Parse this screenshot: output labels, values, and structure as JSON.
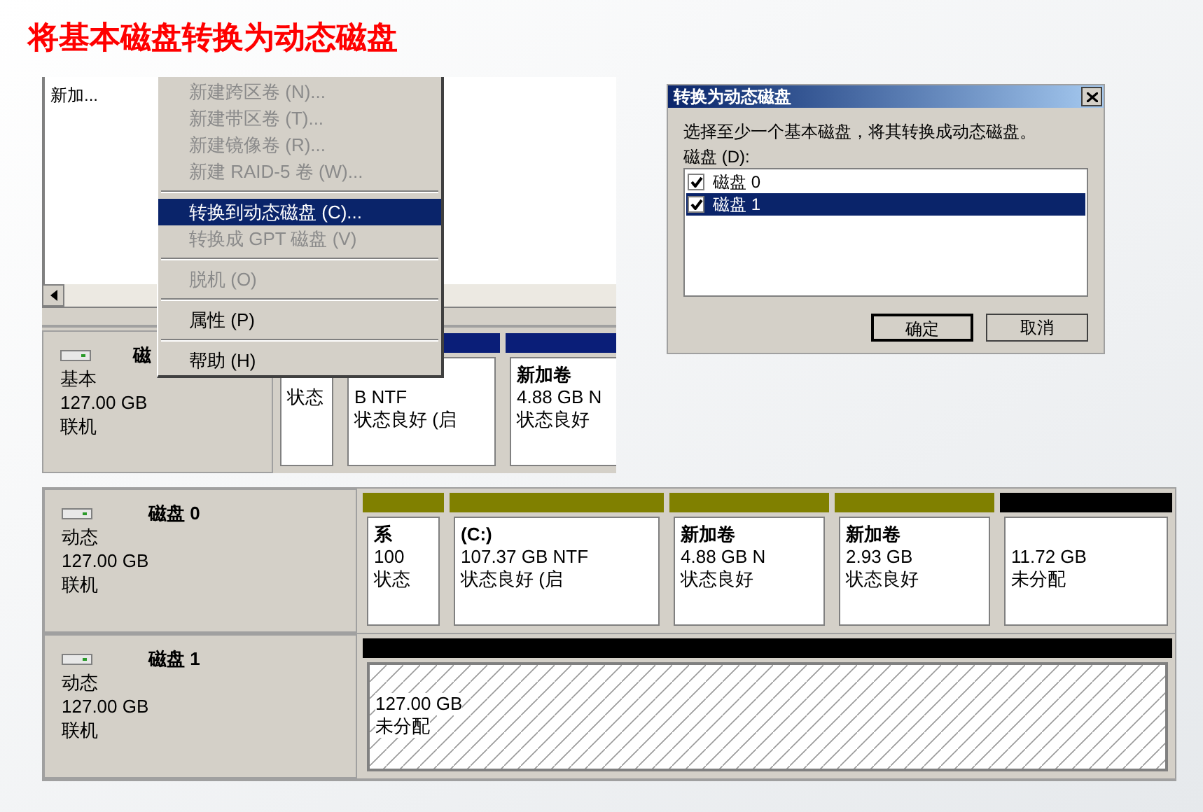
{
  "title": "将基本磁盘转换为动态磁盘",
  "top_screenshot": {
    "list_item": "新加...",
    "disk": {
      "name": "磁",
      "type": "基本",
      "size": "127.00 GB",
      "status": "联机"
    },
    "partitions": [
      {
        "lines": [
          "状态"
        ]
      },
      {
        "color": "#0a1e78",
        "lines": [
          "B NTF",
          "状态良好 (启"
        ]
      },
      {
        "color": "#0a1e78",
        "title": "新加卷",
        "lines": [
          "4.88 GB N",
          "状态良好"
        ]
      }
    ],
    "context_menu": [
      {
        "kind": "item",
        "label": "新建跨区卷 (N)...",
        "disabled": true,
        "selected": false
      },
      {
        "kind": "item",
        "label": "新建带区卷 (T)...",
        "disabled": true,
        "selected": false
      },
      {
        "kind": "item",
        "label": "新建镜像卷 (R)...",
        "disabled": true,
        "selected": false
      },
      {
        "kind": "item",
        "label": "新建 RAID-5 卷 (W)...",
        "disabled": true,
        "selected": false
      },
      {
        "kind": "separator"
      },
      {
        "kind": "item",
        "label": "转换到动态磁盘 (C)...",
        "disabled": false,
        "selected": true
      },
      {
        "kind": "item",
        "label": "转换成 GPT 磁盘 (V)",
        "disabled": true,
        "selected": false
      },
      {
        "kind": "separator"
      },
      {
        "kind": "item",
        "label": "脱机 (O)",
        "disabled": true,
        "selected": false
      },
      {
        "kind": "separator"
      },
      {
        "kind": "item",
        "label": "属性 (P)",
        "disabled": false,
        "selected": false
      },
      {
        "kind": "separator"
      },
      {
        "kind": "item",
        "label": "帮助 (H)",
        "disabled": false,
        "selected": false
      }
    ]
  },
  "dialog": {
    "title": "转换为动态磁盘",
    "prompt": "选择至少一个基本磁盘，将其转换成动态磁盘。",
    "list_label": "磁盘 (D):",
    "disks": [
      {
        "label": "磁盘 0",
        "checked": true,
        "selected": false
      },
      {
        "label": "磁盘 1",
        "checked": true,
        "selected": true
      }
    ],
    "buttons": [
      "确定",
      "取消"
    ]
  },
  "disks": [
    {
      "name": "磁盘 0",
      "type": "动态",
      "size": "127.00 GB",
      "status": "联机",
      "partitions": [
        {
          "kind": "volume",
          "color": "#808000",
          "selected": false,
          "title": "系",
          "lines": [
            "100",
            "状态"
          ]
        },
        {
          "kind": "volume",
          "color": "#808000",
          "selected": false,
          "title": "(C:)",
          "lines": [
            "107.37 GB NTF",
            "状态良好 (启"
          ]
        },
        {
          "kind": "volume",
          "color": "#808000",
          "selected": false,
          "title": "新加卷",
          "lines": [
            "4.88 GB N",
            "状态良好"
          ]
        },
        {
          "kind": "volume",
          "color": "#808000",
          "selected": false,
          "title": "新加卷",
          "lines": [
            "2.93 GB",
            "状态良好"
          ]
        },
        {
          "kind": "unallocated",
          "color": "#000000",
          "selected": false,
          "lines": [
            "11.72 GB",
            "未分配"
          ]
        }
      ]
    },
    {
      "name": "磁盘 1",
      "type": "动态",
      "size": "127.00 GB",
      "status": "联机",
      "partitions": [
        {
          "kind": "unallocated",
          "color": "#000000",
          "selected": true,
          "lines": [
            "127.00 GB",
            "未分配"
          ]
        }
      ]
    }
  ]
}
